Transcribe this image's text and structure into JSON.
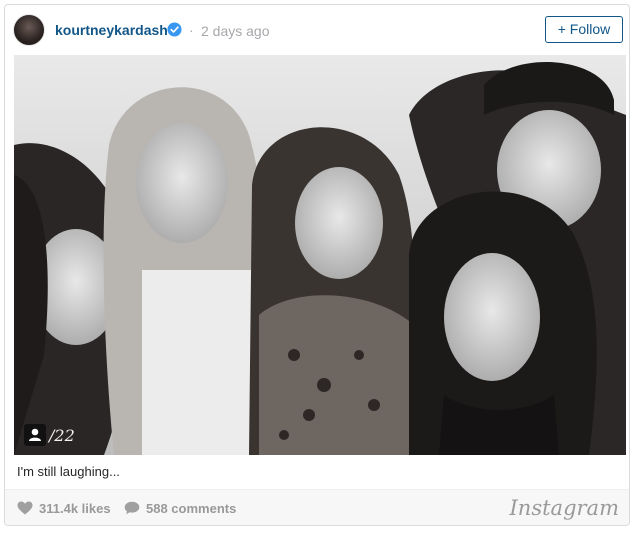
{
  "post": {
    "username": "kourtneykardash",
    "separator": "·",
    "time_ago": "2 days ago",
    "follow_label": "+ Follow",
    "photo_overlay_text": "/22",
    "caption": "I'm still laughing...",
    "likes": "311.4k likes",
    "comments": "588 comments",
    "brand": "Instagram"
  },
  "colors": {
    "link_blue": "#125688",
    "verified_blue": "#3897f0",
    "muted_gray": "#999999"
  },
  "icons": {
    "verified": "verified-badge-icon",
    "tag": "person-tag-icon",
    "like": "heart-icon",
    "comment": "speech-bubble-icon"
  }
}
